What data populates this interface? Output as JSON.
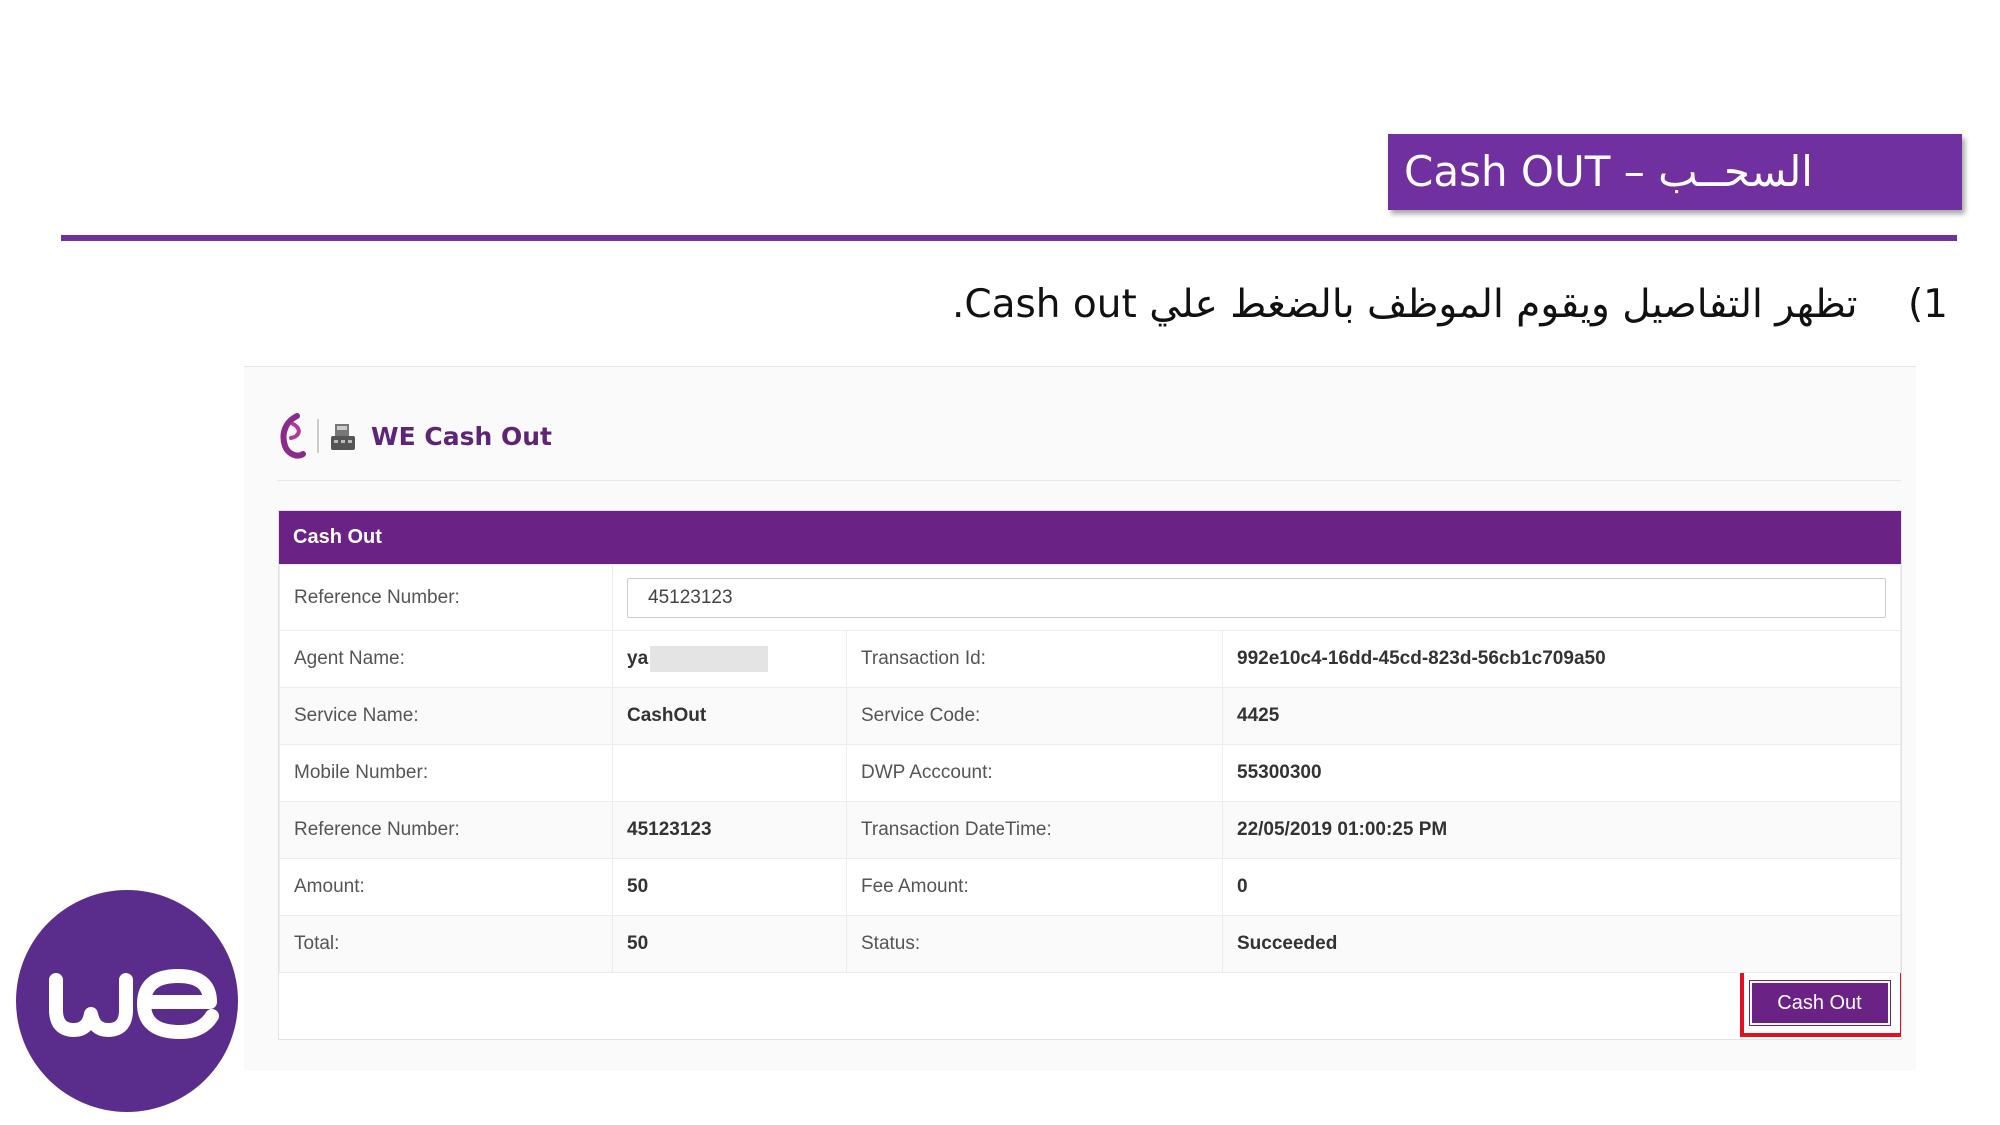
{
  "slide": {
    "title": "Cash OUT – السحــب",
    "instruction_number": "1)",
    "instruction_text": "تظهر التفاصيل ويقوم الموظف بالضغط علي Cash out."
  },
  "app": {
    "title": "WE Cash Out"
  },
  "panel": {
    "heading": "Cash Out",
    "reference_label": "Reference Number:",
    "reference_value": "45123123",
    "rows": [
      {
        "label1": "Agent Name:",
        "value1": "ya",
        "label2": "Transaction Id:",
        "value2": "992e10c4-16dd-45cd-823d-56cb1c709a50"
      },
      {
        "label1": "Service Name:",
        "value1": "CashOut",
        "label2": "Service Code:",
        "value2": "4425"
      },
      {
        "label1": "Mobile Number:",
        "value1": "",
        "label2": "DWP Acccount:",
        "value2": "55300300"
      },
      {
        "label1": "Reference Number:",
        "value1": "45123123",
        "label2": "Transaction DateTime:",
        "value2": "22/05/2019 01:00:25 PM"
      },
      {
        "label1": "Amount:",
        "value1": "50",
        "label2": "Fee Amount:",
        "value2": "0"
      },
      {
        "label1": "Total:",
        "value1": "50",
        "label2": "Status:",
        "value2": "Succeeded"
      }
    ],
    "button_label": "Cash Out"
  },
  "logo": {
    "text": "we"
  },
  "colors": {
    "brand_purple": "#7030a0",
    "panel_purple": "#6a2384",
    "highlight_red": "#e0121e"
  }
}
